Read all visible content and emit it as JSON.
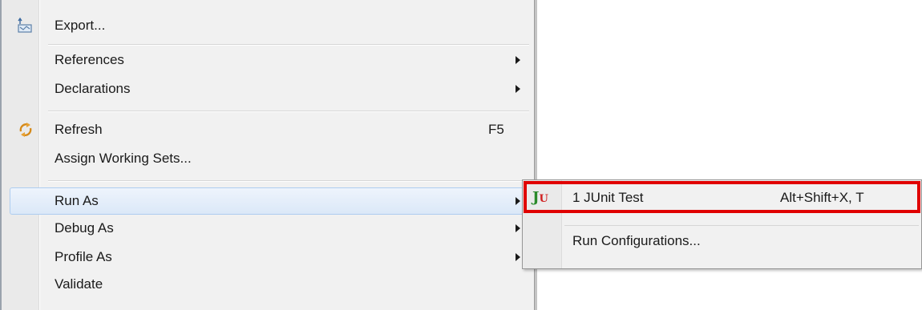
{
  "context_menu": {
    "items": {
      "export": {
        "label": "Export...",
        "icon": "export-icon"
      },
      "references": {
        "label": "References",
        "icon": null
      },
      "declarations": {
        "label": "Declarations",
        "icon": null
      },
      "refresh": {
        "label": "Refresh",
        "shortcut": "F5",
        "icon": "refresh-icon"
      },
      "assign_working_sets": {
        "label": "Assign Working Sets..."
      },
      "run_as": {
        "label": "Run As",
        "highlighted": true
      },
      "debug_as": {
        "label": "Debug As"
      },
      "profile_as": {
        "label": "Profile As"
      },
      "validate": {
        "label": "Validate"
      }
    }
  },
  "submenu": {
    "parent": "Run As",
    "items": {
      "junit_test": {
        "label": "1 JUnit Test",
        "shortcut": "Alt+Shift+X, T",
        "icon": "junit-icon",
        "icon_text_j": "J",
        "icon_text_u": "U"
      },
      "run_configurations": {
        "label": "Run Configurations..."
      }
    }
  },
  "colors": {
    "menu_background": "#f1f1f1",
    "highlight_fill": "#dbe8f8",
    "highlight_border": "#aecdf0",
    "annotation_red": "#e00000",
    "junit_green": "#2a8a2a",
    "junit_red": "#d02020"
  }
}
